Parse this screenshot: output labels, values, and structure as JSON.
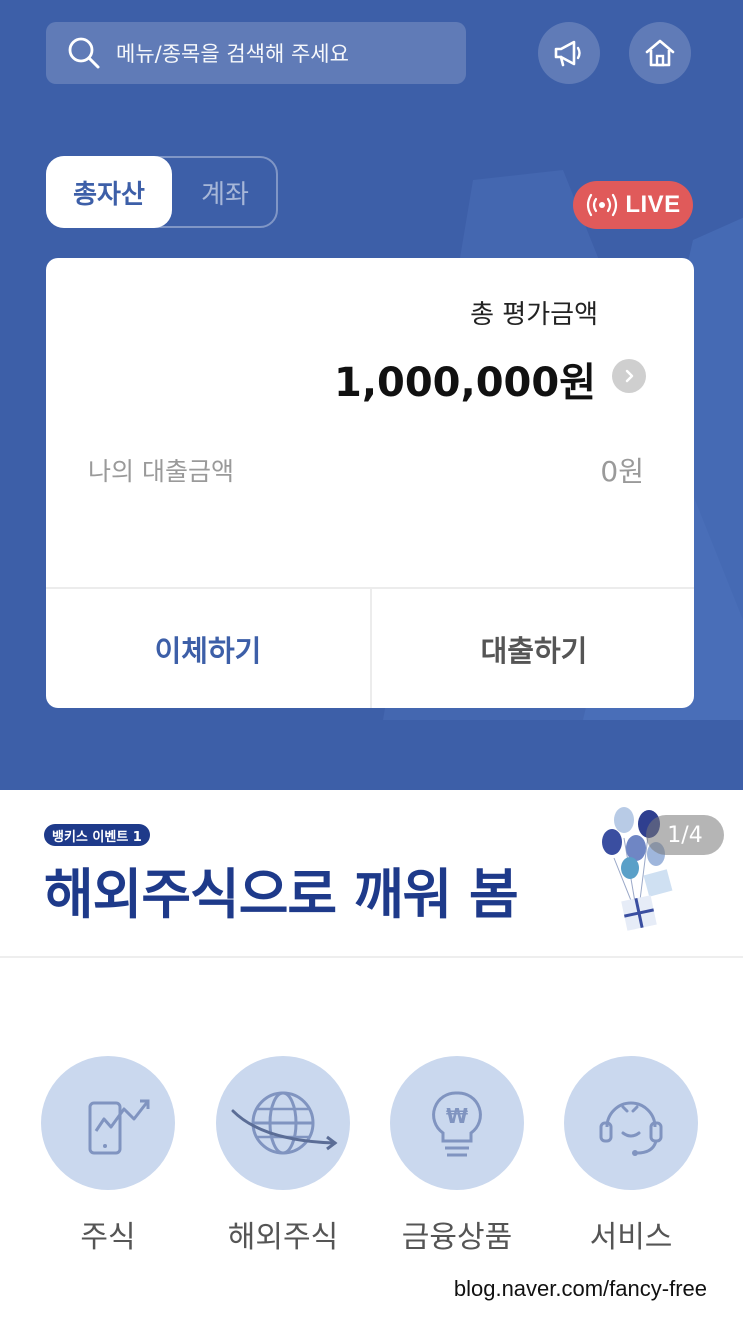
{
  "header": {
    "search_placeholder": "메뉴/종목을 검색해 주세요",
    "icons": [
      "search-icon",
      "megaphone-icon",
      "home-icon"
    ]
  },
  "tabs": [
    {
      "label": "총자산",
      "active": true
    },
    {
      "label": "계좌",
      "active": false
    }
  ],
  "live_badge": {
    "label": "LIVE",
    "color": "#e05a5a"
  },
  "asset_card": {
    "total_label": "총 평가금액",
    "total_value": "1,000,000원",
    "loan_label": "나의 대출금액",
    "loan_value": "0원",
    "actions": [
      {
        "label": "이체하기"
      },
      {
        "label": "대출하기"
      }
    ]
  },
  "banner": {
    "tag": "뱅키스 이벤트 1",
    "headline": "해외주식으로 깨워 봄",
    "pager": "1/4"
  },
  "menu": [
    {
      "label": "주식",
      "icon": "stock-chart-icon"
    },
    {
      "label": "해외주식",
      "icon": "globe-icon"
    },
    {
      "label": "금융상품",
      "icon": "lightbulb-won-icon"
    },
    {
      "label": "서비스",
      "icon": "headset-icon"
    }
  ],
  "footer": {
    "watermark": "blog.naver.com/fancy-free"
  },
  "colors": {
    "brand": "#3d5fa8",
    "accent_dark": "#1e3a8a",
    "menu_circle": "#cad8ee"
  }
}
